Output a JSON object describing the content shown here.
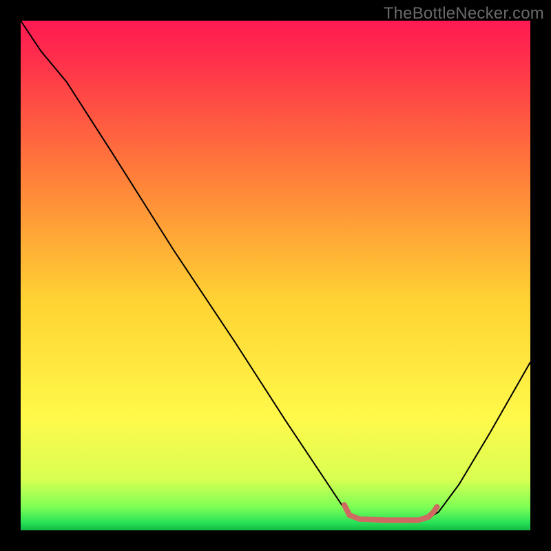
{
  "watermark": "TheBottleNecker.com",
  "chart_data": {
    "type": "line",
    "title": "",
    "xlabel": "",
    "ylabel": "",
    "xlim": [
      0,
      100
    ],
    "ylim": [
      0,
      100
    ],
    "grid": false,
    "gradient_stops": [
      {
        "offset": 0.0,
        "color": "#ff1a53"
      },
      {
        "offset": 0.06,
        "color": "#ff2a4c"
      },
      {
        "offset": 0.3,
        "color": "#ff7d3a"
      },
      {
        "offset": 0.55,
        "color": "#ffd333"
      },
      {
        "offset": 0.78,
        "color": "#fff94a"
      },
      {
        "offset": 0.9,
        "color": "#d8ff52"
      },
      {
        "offset": 0.955,
        "color": "#7cff55"
      },
      {
        "offset": 0.985,
        "color": "#27e257"
      },
      {
        "offset": 1.0,
        "color": "#14b843"
      }
    ],
    "series": [
      {
        "name": "bottleneck-curve",
        "color": "#000000",
        "stroke_width": 2,
        "points": [
          {
            "x": 0.0,
            "y": 100.0
          },
          {
            "x": 4.0,
            "y": 94.0
          },
          {
            "x": 9.0,
            "y": 88.0
          },
          {
            "x": 18.0,
            "y": 74.0
          },
          {
            "x": 30.0,
            "y": 55.0
          },
          {
            "x": 42.0,
            "y": 37.0
          },
          {
            "x": 52.0,
            "y": 21.5
          },
          {
            "x": 59.0,
            "y": 11.0
          },
          {
            "x": 63.0,
            "y": 5.0
          },
          {
            "x": 64.5,
            "y": 3.2
          },
          {
            "x": 67.0,
            "y": 2.2
          },
          {
            "x": 72.0,
            "y": 1.8
          },
          {
            "x": 78.0,
            "y": 1.8
          },
          {
            "x": 80.0,
            "y": 2.4
          },
          {
            "x": 82.0,
            "y": 3.6
          },
          {
            "x": 86.0,
            "y": 9.0
          },
          {
            "x": 92.0,
            "y": 19.0
          },
          {
            "x": 100.0,
            "y": 33.0
          }
        ]
      },
      {
        "name": "optimal-range-marker",
        "color": "#cf6a62",
        "stroke_width": 8,
        "linecap": "round",
        "points": [
          {
            "x": 63.5,
            "y": 5.0
          },
          {
            "x": 64.5,
            "y": 3.0
          },
          {
            "x": 66.5,
            "y": 2.2
          },
          {
            "x": 72.0,
            "y": 2.0
          },
          {
            "x": 78.0,
            "y": 2.0
          },
          {
            "x": 80.0,
            "y": 2.6
          },
          {
            "x": 81.0,
            "y": 3.6
          },
          {
            "x": 81.7,
            "y": 4.6
          }
        ]
      }
    ]
  }
}
